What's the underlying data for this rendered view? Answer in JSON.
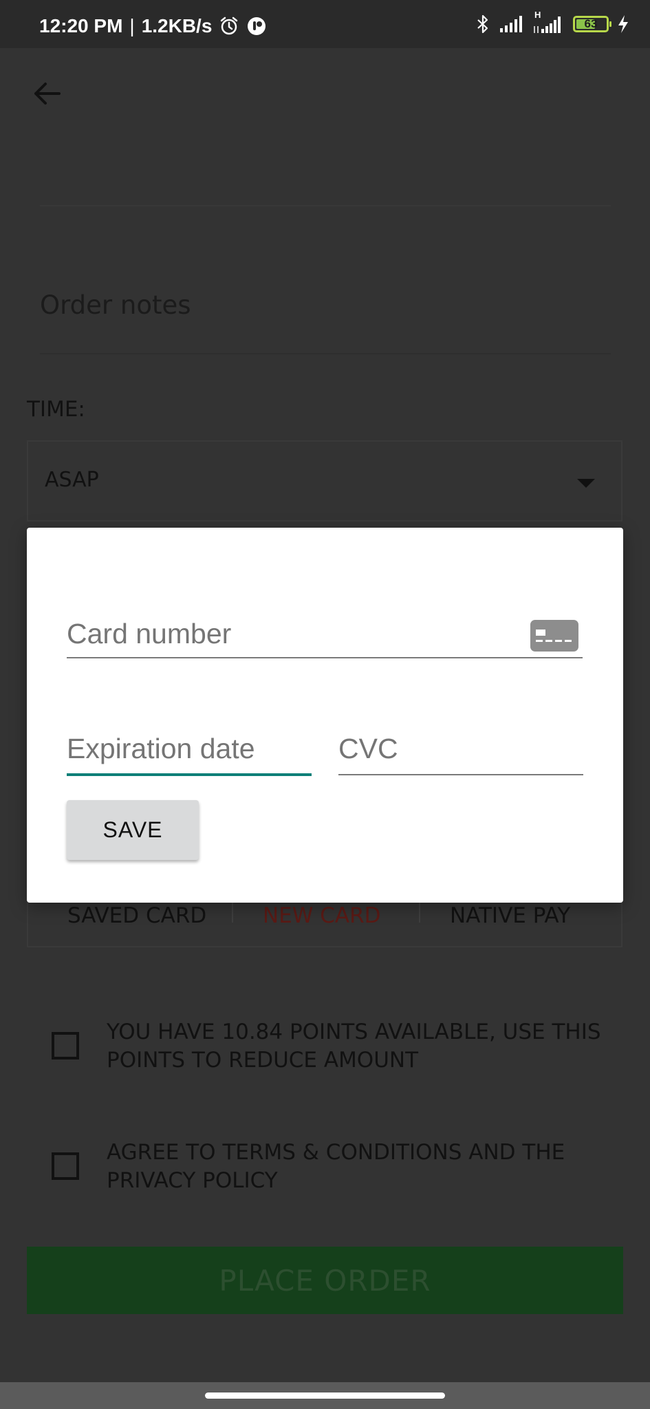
{
  "status_bar": {
    "time": "12:20 PM",
    "separator": "|",
    "speed": "1.2KB/s",
    "network_type": "H",
    "battery": "63",
    "icons": [
      "alarm-icon",
      "app-notification-icon",
      "bluetooth-icon",
      "signal-icon",
      "signal-h-icon",
      "battery-icon",
      "charging-icon"
    ]
  },
  "header": {
    "back_icon": "arrow-back-icon"
  },
  "form": {
    "order_notes_label": "Order notes",
    "time_label": "TIME:",
    "time_value": "ASAP"
  },
  "payment_tabs": {
    "saved_card": "SAVED CARD",
    "new_card": "NEW CARD",
    "native_pay": "NATIVE PAY",
    "active_color": "#7a1c16"
  },
  "options": {
    "points": "YOU HAVE 10.84 POINTS AVAILABLE, USE THIS POINTS TO REDUCE AMOUNT",
    "terms": "AGREE TO TERMS & CONDITIONS AND THE PRIVACY POLICY"
  },
  "place_order": {
    "label": "PLACE ORDER",
    "color": "#15401b"
  },
  "dialog": {
    "card_number_placeholder": "Card number",
    "expiration_placeholder": "Expiration date",
    "cvc_placeholder": "CVC",
    "save_label": "SAVE",
    "focus_color": "#0b7f78"
  }
}
